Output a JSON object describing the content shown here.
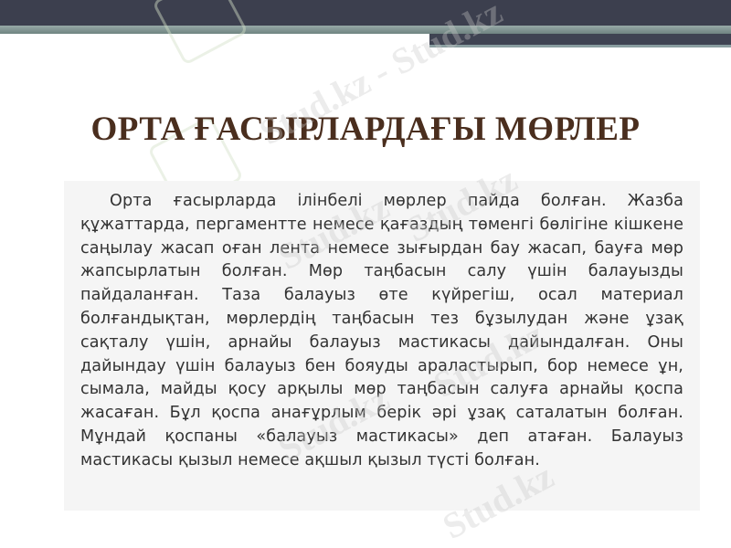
{
  "slide": {
    "title": "ОРТА ҒАСЫРЛАРДАҒЫ МӨРЛЕР",
    "body": "Орта ғасырларда ілінбелі мөрлер пайда болған. Жазба құжаттарда, пергаментте немесе қағаздың төменгі бөлігіне кішкене саңылау жасап оған лента немесе зығырдан бау жасап, бауға мөр жапсырлатын болған. Мөр таңбасын салу үшін балауызды пайдаланған. Таза балауыз өте күйрегіш, осал материал болғандықтан, мөрлердің таңбасын тез бұзылудан және ұзақ сақталу үшін, арнайы балауыз мастикасы дайындалған. Оны дайындау үшін балауыз бен бояуды араластырып, бор немесе ұн, сымала, майды қосу арқылы мөр таңбасын салуға арнайы қоспа жасаған. Бұл қоспа анағұрлым берік әрі ұзақ саталатын болған. Мұндай қоспаны «балауыз мастикасы» деп атаған. Балауыз мастикасы қызыл немесе ақшыл қызыл түсті болған."
  },
  "watermark": {
    "text": "Stud.kz",
    "text_long": "Stud.kz - Stud.kz"
  },
  "colors": {
    "title": "#4a2e1e",
    "topbar": "#3c3f4e",
    "band": "#8a9ea0"
  }
}
